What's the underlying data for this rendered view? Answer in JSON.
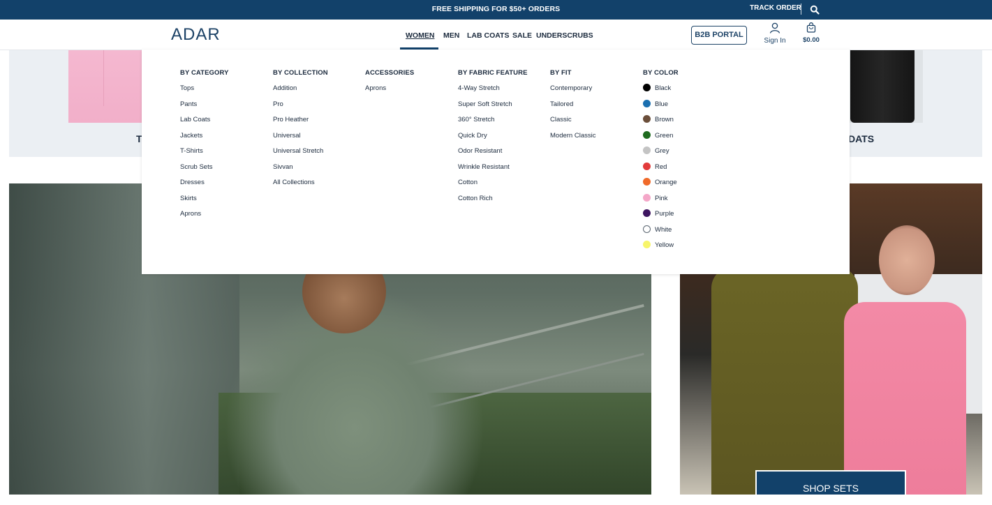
{
  "announcement": {
    "text": "FREE SHIPPING FOR $50+ ORDERS",
    "track_order": "TRACK ORDER",
    "search_icon": "search-icon"
  },
  "header": {
    "logo": "ADAR",
    "nav": [
      {
        "label": "WOMEN",
        "active": true
      },
      {
        "label": "MEN",
        "active": false
      },
      {
        "label": "LAB COATS",
        "active": false
      },
      {
        "label": "SALE",
        "active": false
      },
      {
        "label": "UNDERSCRUBS",
        "active": false
      }
    ],
    "b2b_label": "B2B PORTAL",
    "signin_label": "Sign In",
    "cart_total": "$0.00",
    "accent": "#12416a"
  },
  "background": {
    "card_title_left": "T",
    "card_title_right": "DATS",
    "shop_sets_label": "SHOP SETS"
  },
  "mega_menu": {
    "columns": [
      {
        "heading": "BY CATEGORY",
        "items": [
          "Tops",
          "Pants",
          "Lab Coats",
          "Jackets",
          "T-Shirts",
          "Scrub Sets",
          "Dresses",
          "Skirts",
          "Aprons"
        ]
      },
      {
        "heading": "BY COLLECTION",
        "items": [
          "Addition",
          "Pro",
          "Pro Heather",
          "Universal",
          "Universal Stretch",
          "Sivvan",
          "All Collections"
        ]
      },
      {
        "heading": "ACCESSORIES",
        "items": [
          "Aprons"
        ]
      },
      {
        "heading": "BY FABRIC FEATURE",
        "items": [
          "4-Way Stretch",
          "Super Soft Stretch",
          "360° Stretch",
          "Quick Dry",
          "Odor Resistant",
          "Wrinkle Resistant",
          "Cotton",
          "Cotton Rich"
        ]
      },
      {
        "heading": "BY FIT",
        "items": [
          "Contemporary",
          "Tailored",
          "Classic",
          "Modern Classic"
        ]
      }
    ],
    "color_column": {
      "heading": "BY COLOR",
      "items": [
        {
          "label": "Black",
          "color": "#000000"
        },
        {
          "label": "Blue",
          "color": "#1a6fb0"
        },
        {
          "label": "Brown",
          "color": "#6b4e3a"
        },
        {
          "label": "Green",
          "color": "#1f6b1f"
        },
        {
          "label": "Grey",
          "color": "#c4c4c4"
        },
        {
          "label": "Red",
          "color": "#e23b3b"
        },
        {
          "label": "Orange",
          "color": "#f06a2a"
        },
        {
          "label": "Pink",
          "color": "#f4a7c8"
        },
        {
          "label": "Purple",
          "color": "#3d1560"
        },
        {
          "label": "White",
          "color": "#ffffff"
        },
        {
          "label": "Yellow",
          "color": "#f7f56a"
        }
      ]
    }
  }
}
